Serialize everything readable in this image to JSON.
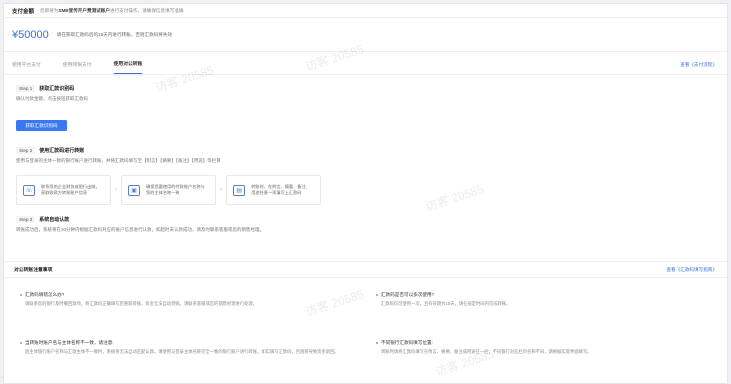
{
  "header": {
    "title": "支付金额",
    "desc_prefix": "您即将为",
    "desc_strong": "SMB宣传开户费测试账户",
    "desc_suffix": "进行支付操作，请确保信息填写准确"
  },
  "amount": {
    "value": "¥50000",
    "tip": "请在获取汇款码后的15天内进行转账，否则汇款码将失效"
  },
  "tabs": {
    "items": [
      "使用平台支付",
      "使用网银支付",
      "使用对公转账"
    ],
    "active_index": 2,
    "link": "查看《支付流程》"
  },
  "steps": {
    "step1": {
      "no": "Step 1",
      "title": "获取汇款识别码",
      "desc": "确认付款金额，点击按钮获取汇款码",
      "button": "获取汇款识别码"
    },
    "step2": {
      "no": "Step 2",
      "title": "使用汇款码进行转账",
      "desc": "使用与登录的主体一致的银行账户进行转账，并将汇款码填写至【附言】【摘要】【备注】【用途】等栏目"
    },
    "step3": {
      "no": "Step 3",
      "title": "系统自动认款",
      "desc": "转账成功后，系统将在30分钟内根据汇款码对应的账户信息进行认款，如超时未认款成功，请及时联系客服或您的销售经理。"
    }
  },
  "methods": [
    {
      "icon": "☏",
      "icon_name": "phone-icon",
      "text": "联系您的企业财务或银行出纳，获取收款方转账账户信息"
    },
    {
      "icon": "▣",
      "icon_name": "card-icon",
      "text": "确保您要使用的付款账户名称与您的主体名称一致"
    },
    {
      "icon": "▤",
      "icon_name": "document-icon",
      "text": "转账时，在附言、摘要、备注、用途任意一项填写上汇款码"
    }
  ],
  "notes": {
    "title": "对公转账注意事项",
    "link": "查看《汇款码填写指南》",
    "items": [
      {
        "q": "汇款码填错怎么办?",
        "a": "请联系您的银行及时撤回款项，将汇款码正确填写后重新转账，资金无法自动到账。请联系客服或您的销售经理进行处理。"
      },
      {
        "q": "汇款码是否可以多次使用?",
        "a": "汇款码仅可使用一次，且有效期为15天，请在规定时间内完成转账。"
      },
      {
        "q": "当转账时账户名与主体名称不一致，请注意:",
        "a": "因主体银行账户名称与汇款主体不一致时，系统将无法自动匹配认款。请使用与登录主体名称完全一致的银行账户进行转账，如实填写汇款码，否则将导致资金退回。"
      },
      {
        "q": "不同银行汇款码填写位置:",
        "a": "转账时请将汇款码填写在附言、摘要、备注或用途任一栏，不同银行对应栏目名称不同，请根据实际界面填写。"
      }
    ]
  },
  "watermark": "访客 20585"
}
